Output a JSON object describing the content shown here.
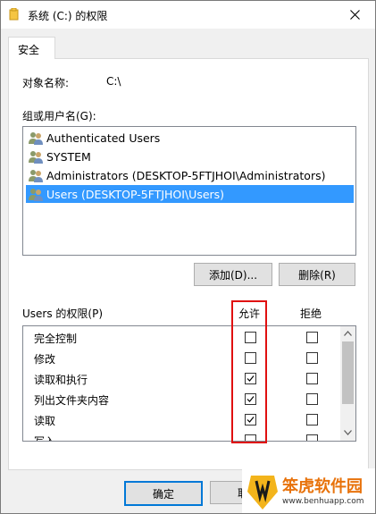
{
  "window": {
    "title": "系统 (C:) 的权限",
    "close_icon": "close-icon"
  },
  "tabs": [
    {
      "label": "安全",
      "selected": true
    }
  ],
  "object": {
    "label": "对象名称:",
    "value": "C:\\"
  },
  "groups": {
    "label": "组或用户名(G):",
    "items": [
      {
        "label": "Authenticated Users",
        "selected": false
      },
      {
        "label": "SYSTEM",
        "selected": false
      },
      {
        "label": "Administrators (DESKTOP-5FTJHOI\\Administrators)",
        "selected": false
      },
      {
        "label": "Users (DESKTOP-5FTJHOI\\Users)",
        "selected": true
      }
    ],
    "add_button": "添加(D)...",
    "remove_button": "删除(R)"
  },
  "permissions": {
    "label": "Users 的权限(P)",
    "allow_header": "允许",
    "deny_header": "拒绝",
    "rows": [
      {
        "name": "完全控制",
        "allow": false,
        "deny": false
      },
      {
        "name": "修改",
        "allow": false,
        "deny": false
      },
      {
        "name": "读取和执行",
        "allow": true,
        "deny": false
      },
      {
        "name": "列出文件夹内容",
        "allow": true,
        "deny": false
      },
      {
        "name": "读取",
        "allow": true,
        "deny": false
      },
      {
        "name": "写入",
        "allow": false,
        "deny": false
      }
    ]
  },
  "footer": {
    "ok_button": "确定",
    "cancel_button": "取"
  },
  "watermark": {
    "text": "笨虎软件园",
    "url": "www.benhuapp.com"
  },
  "colors": {
    "selection": "#3399ff",
    "highlight_border": "#e01010",
    "accent": "#0078d7"
  }
}
